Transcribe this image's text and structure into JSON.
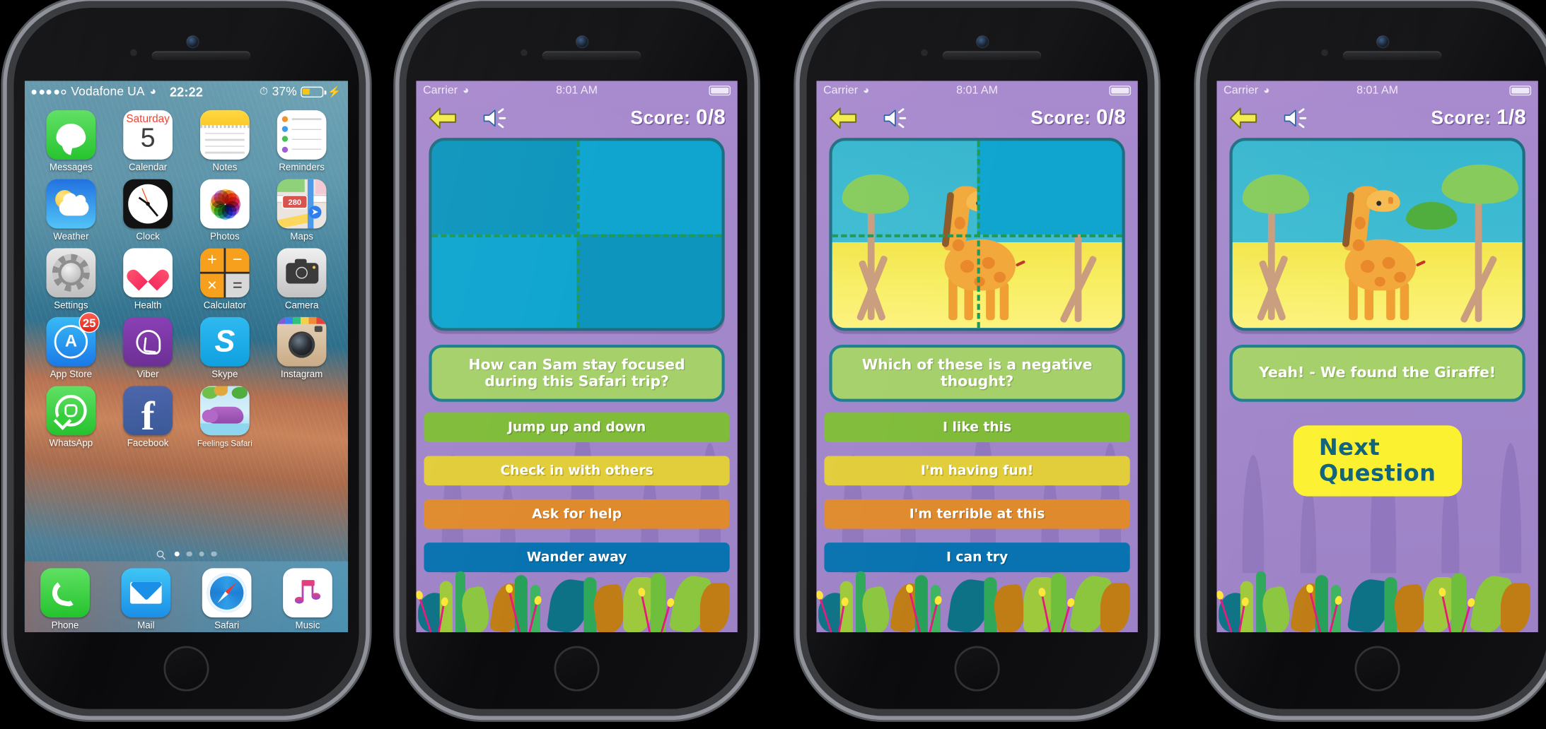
{
  "phones": [
    {
      "id": "phone-home-screen",
      "kind": "ios-home",
      "status_bar": {
        "carrier": "Vodafone UA",
        "signal_dots": 5,
        "signal_filled": 4,
        "wifi_icon": "wifi-icon",
        "time": "22:22",
        "alarm_icon": "alarm-clock-icon",
        "battery_percent": "37%",
        "battery_level": 37,
        "charging_icon": "lightning-bolt-icon"
      },
      "apps": [
        {
          "label": "Messages",
          "icon": "messages-icon"
        },
        {
          "label": "Calendar",
          "icon": "calendar-icon",
          "weekday": "Saturday",
          "day": "5"
        },
        {
          "label": "Notes",
          "icon": "notes-icon"
        },
        {
          "label": "Reminders",
          "icon": "reminders-icon"
        },
        {
          "label": "Weather",
          "icon": "weather-icon"
        },
        {
          "label": "Clock",
          "icon": "clock-icon"
        },
        {
          "label": "Photos",
          "icon": "photos-icon"
        },
        {
          "label": "Maps",
          "icon": "maps-icon",
          "route": "280"
        },
        {
          "label": "Settings",
          "icon": "settings-gear-icon"
        },
        {
          "label": "Health",
          "icon": "health-heart-icon"
        },
        {
          "label": "Calculator",
          "icon": "calculator-icon",
          "keys": [
            "+",
            "−",
            "×",
            "="
          ]
        },
        {
          "label": "Camera",
          "icon": "camera-icon"
        },
        {
          "label": "App Store",
          "icon": "app-store-icon",
          "badge": "25"
        },
        {
          "label": "Viber",
          "icon": "viber-icon"
        },
        {
          "label": "Skype",
          "icon": "skype-icon",
          "glyph": "S"
        },
        {
          "label": "Instagram",
          "icon": "instagram-icon"
        },
        {
          "label": "WhatsApp",
          "icon": "whatsapp-icon"
        },
        {
          "label": "Facebook",
          "icon": "facebook-icon",
          "glyph": "f"
        },
        {
          "label": "Feelings Safari",
          "icon": "feelings-safari-app-icon"
        }
      ],
      "page_dots": {
        "count": 4,
        "active_index": 0,
        "search_icon": "search-icon"
      },
      "dock": [
        {
          "label": "Phone",
          "icon": "phone-handset-icon"
        },
        {
          "label": "Mail",
          "icon": "mail-envelope-icon"
        },
        {
          "label": "Safari",
          "icon": "safari-compass-icon"
        },
        {
          "label": "Music",
          "icon": "music-note-icon"
        }
      ]
    },
    {
      "id": "phone-question-1",
      "kind": "game",
      "status_bar": {
        "carrier": "Carrier",
        "wifi_icon": "wifi-icon",
        "time": "8:01 AM"
      },
      "nav": {
        "back_icon": "back-arrow-icon",
        "sound_icon": "speaker-sound-icon",
        "score_label": "Score:",
        "score_value": "0/8"
      },
      "image_panel": {
        "revealed_quadrants": [],
        "covered_quadrants": [
          "top-left",
          "top-right",
          "bottom-left",
          "bottom-right"
        ],
        "divider": "dashed-cross"
      },
      "question": "How can Sam stay focused during this Safari trip?",
      "answers": [
        {
          "label": "Jump up and down",
          "color": "#80bc3a"
        },
        {
          "label": "Check in with others",
          "color": "#e2cd3a"
        },
        {
          "label": "Ask for help",
          "color": "#e08a2e"
        },
        {
          "label": "Wander away",
          "color": "#0873b0"
        }
      ]
    },
    {
      "id": "phone-question-2",
      "kind": "game",
      "status_bar": {
        "carrier": "Carrier",
        "wifi_icon": "wifi-icon",
        "time": "8:01 AM"
      },
      "nav": {
        "back_icon": "back-arrow-icon",
        "sound_icon": "speaker-sound-icon",
        "score_label": "Score:",
        "score_value": "0/8"
      },
      "image_panel": {
        "revealed_quadrants": [
          "top-left",
          "bottom-left",
          "bottom-right"
        ],
        "covered_quadrants": [
          "top-right"
        ],
        "divider": "dashed-cross",
        "scene": "giraffe-savanna"
      },
      "question": "Which of these is a negative thought?",
      "answers": [
        {
          "label": "I like this",
          "color": "#80bc3a"
        },
        {
          "label": "I'm having fun!",
          "color": "#e2cd3a"
        },
        {
          "label": "I'm terrible at this",
          "color": "#e08a2e"
        },
        {
          "label": "I can try",
          "color": "#0873b0"
        }
      ]
    },
    {
      "id": "phone-result",
      "kind": "game-result",
      "status_bar": {
        "carrier": "Carrier",
        "wifi_icon": "wifi-icon",
        "time": "8:01 AM"
      },
      "nav": {
        "back_icon": "back-arrow-icon",
        "sound_icon": "speaker-sound-icon",
        "score_label": "Score:",
        "score_value": "1/8"
      },
      "image_panel": {
        "revealed_quadrants": [
          "top-left",
          "top-right",
          "bottom-left",
          "bottom-right"
        ],
        "covered_quadrants": [],
        "divider": "none",
        "scene": "giraffe-savanna"
      },
      "question": "Yeah! - We found the Giraffe!",
      "next_button": "Next Question"
    }
  ],
  "colors": {
    "app_background": "#a88ace",
    "panel_border": "#1d6f80",
    "question_box": "#a5d06a",
    "cover_tile": "#0fa5cf",
    "next_button": "#fcf131",
    "next_button_text": "#12647d",
    "score_text": "#ffffff",
    "back_arrow": "#f2ec4a"
  }
}
